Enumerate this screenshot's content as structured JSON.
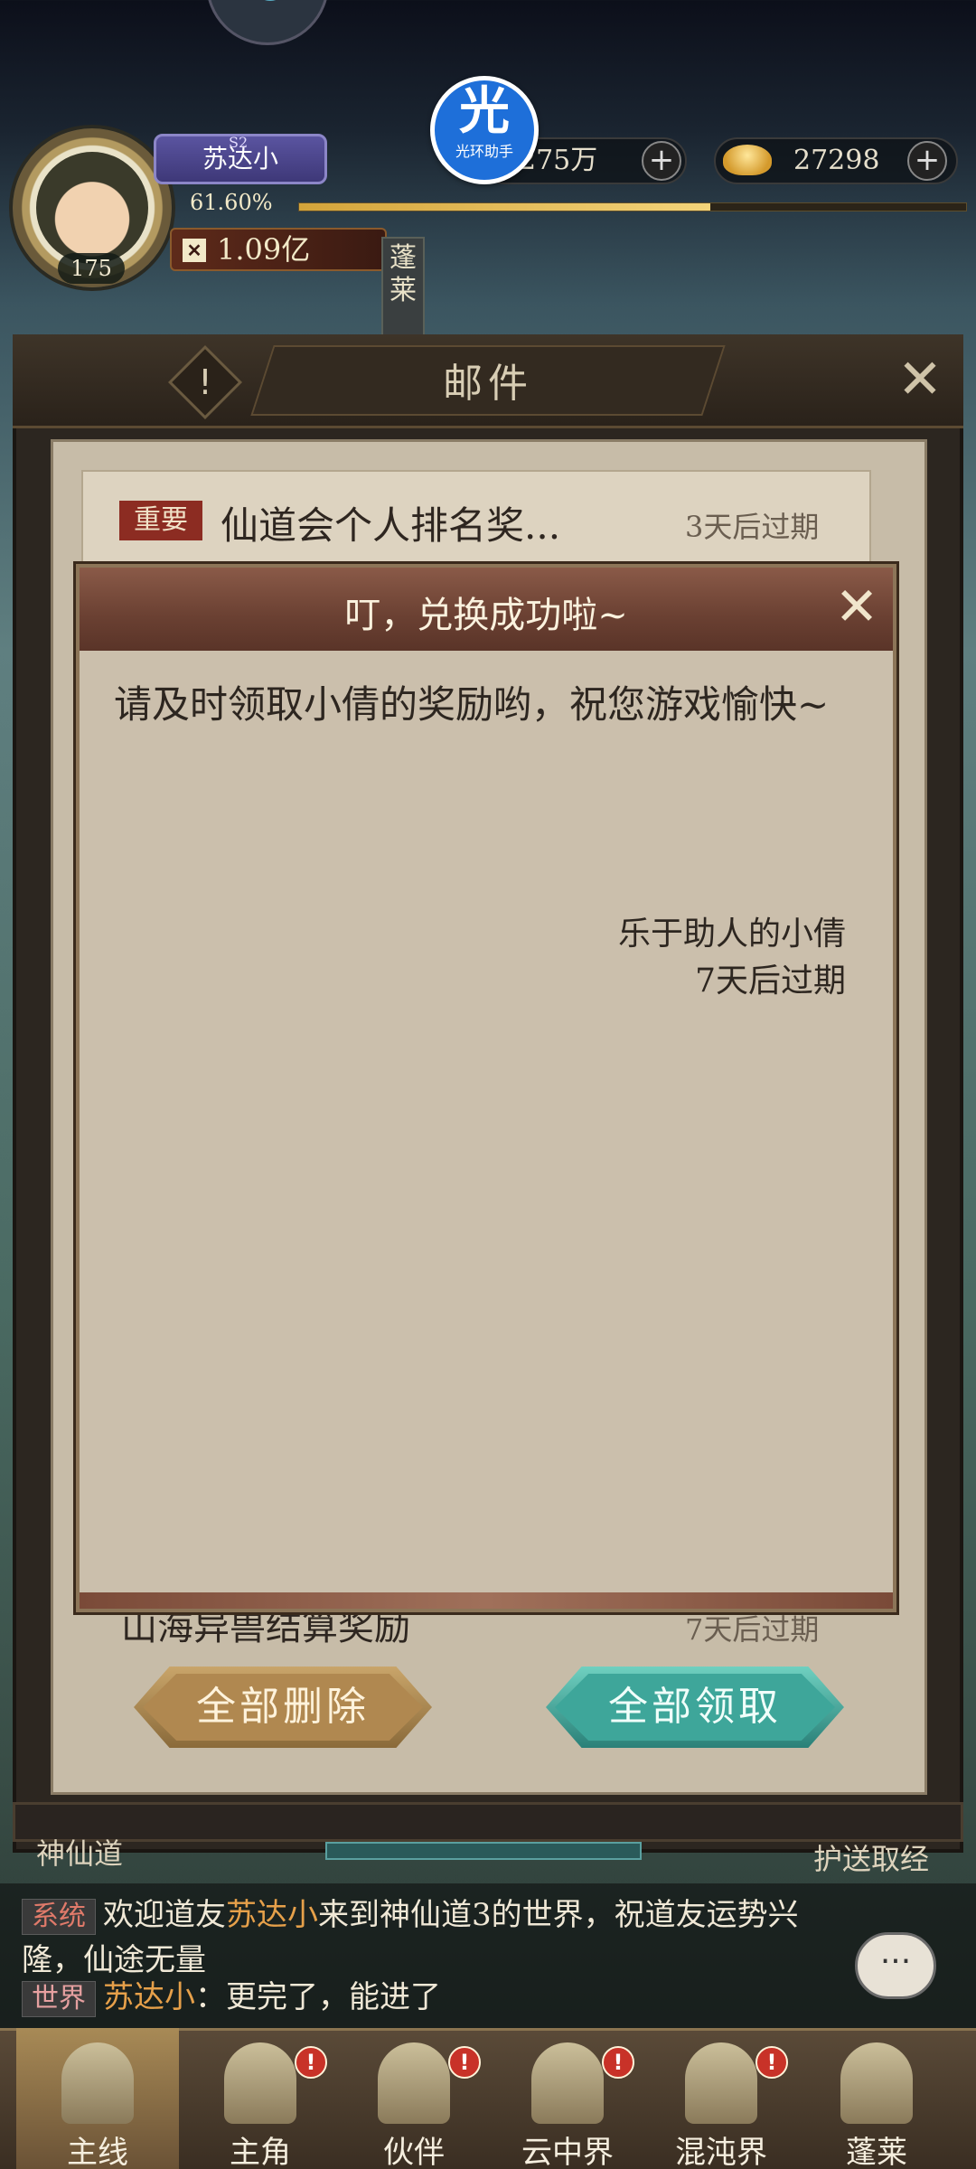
{
  "hud": {
    "player_name": "苏达小",
    "server_tag": "S2",
    "exp_percent": "61.60%",
    "exp_fill": 0.616,
    "level": "175",
    "power": "1.09亿",
    "copper": "275万",
    "gold": "27298",
    "side_tag": "蓬莱"
  },
  "overlay_badge": {
    "glyph": "光",
    "label": "光环助手"
  },
  "mail": {
    "title": "邮件",
    "info_button": "!",
    "close_button": "✕",
    "items": [
      {
        "tag": "重要",
        "title": "仙道会个人排名奖...",
        "expire": "3天后过期"
      },
      {
        "title": "山海异兽结算奖励",
        "expire": "7天后过期"
      }
    ],
    "delete_all": "全部删除",
    "claim_all": "全部领取"
  },
  "popup": {
    "title": "叮，兑换成功啦~",
    "close_button": "✕",
    "body": "请及时领取小倩的奖励哟，祝您游戏愉快~",
    "sender": "乐于助人的小倩",
    "expire": "7天后过期"
  },
  "under_panel": {
    "left_label": "神仙道",
    "right_label": "护送取经"
  },
  "chat": {
    "line1": {
      "tag": "系统",
      "pre": "欢迎道友",
      "name": "苏达小",
      "post": "来到神仙道3的世界，祝道友运势兴隆，仙途无量"
    },
    "line2": {
      "tag": "世界",
      "name": "苏达小",
      "post": "：更完了，能进了"
    },
    "bubble": "···"
  },
  "nav": [
    {
      "label": "主线",
      "alert": ""
    },
    {
      "label": "主角",
      "alert": "!"
    },
    {
      "label": "伙伴",
      "alert": "!"
    },
    {
      "label": "云中界",
      "alert": "!"
    },
    {
      "label": "混沌界",
      "alert": "!"
    },
    {
      "label": "蓬莱",
      "alert": ""
    }
  ]
}
